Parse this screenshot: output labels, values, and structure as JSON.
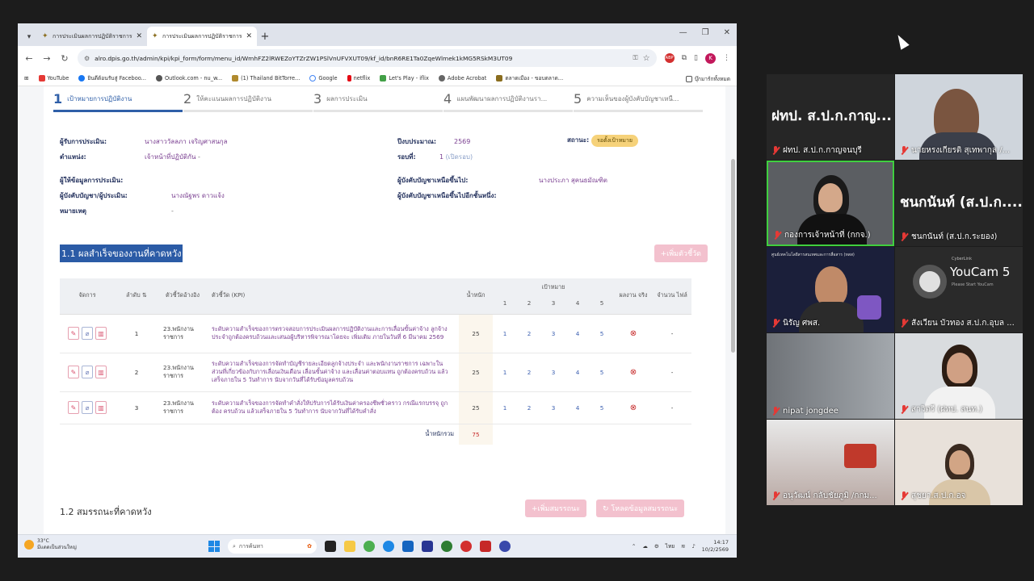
{
  "browser": {
    "tabs": [
      {
        "title": "การประเมินผลการปฏิบัติราชการ - ระ"
      },
      {
        "title": "การประเมินผลการปฏิบัติราชการ - ระ"
      }
    ],
    "url": "alro.dpis.go.th/admin/kpi/kpi_form/form/menu_id/WmhFZ2lRWEZoYTZrZW1PSlVnUFVXUT09/kf_id/bnR6RE1Ta0ZqeWlmek1kMG5RSkM3UT09",
    "profile_initial": "K",
    "bookmarks": [
      "YouTube",
      "ยินดีต้อนรับสู่ Faceboo...",
      "Outlook.com - nu_w...",
      "(1) Thailand BitTorre...",
      "Google",
      "netflix",
      "Let's Play - iflix",
      "Adobe Acrobat",
      "ตลาดเมือง - ขอบตลาด..."
    ],
    "bookmarks_all": "บุ๊กมาร์กทั้งหมด"
  },
  "steps": [
    {
      "num": "1",
      "label": "เป้าหมายการปฏิบัติงาน"
    },
    {
      "num": "2",
      "label": "ให้คะแนนผลการปฏิบัติงาน"
    },
    {
      "num": "3",
      "label": "ผลการประเมิน"
    },
    {
      "num": "4",
      "label": "แผนพัฒนาผลการปฏิบัติงานรา..."
    },
    {
      "num": "5",
      "label": "ความเห็นของผู้บังคับบัญชาเหนื..."
    }
  ],
  "info": {
    "assessee_label": "ผู้รับการประเมิน:",
    "assessee": "นางสาววัลลภา เจริญศาสนกุล",
    "position_label": "ตำแหน่ง:",
    "position": "เจ้าหน้าที่ปฏิบัติกัน",
    "position_dash": "-",
    "year_label": "ปีงบประมาณ:",
    "year": "2569",
    "round_label": "รอบที่:",
    "round": "1",
    "round_note": "(เปิดรอบ)",
    "status_label": "สถานะ:",
    "status": "รอตั้งเป้าหมาย",
    "provider_label": "ผู้ให้ข้อมูลการประเมิน:",
    "supervisor_label": "ผู้บังคับบัญชา/ผู้ประเมิน:",
    "supervisor": "นางณัฐพร ดาวแจ้ง",
    "note_label": "หมายเหตุ",
    "note": "-",
    "upper1_label": "ผู้บังคับบัญชาเหนือขึ้นไป:",
    "upper1": "นางประภา สุคนธมัณฑิต",
    "upper2_label": "ผู้บังคับบัญชาเหนือขึ้นไปอีกชั้นหนึ่ง:"
  },
  "section1": {
    "title": "1.1 ผลสำเร็จของงานที่คาดหวัง",
    "add_kpi": "+เพิ่มตัวชี้วัด",
    "headers": {
      "actions": "จัดการ",
      "order": "ลำดับ",
      "ref": "ตัวชี้วัดอ้างอิง",
      "kpi": "ตัวชี้วัด (KPI)",
      "weight": "น้ำหนัก",
      "target": "เป้าหมาย",
      "l1": "1",
      "l2": "2",
      "l3": "3",
      "l4": "4",
      "l5": "5",
      "actual": "ผลงาน จริง",
      "files": "จำนวน ไฟล์"
    },
    "rows": [
      {
        "order": "1",
        "ref": "23.พนักงาน ราชการ",
        "kpi": "ระดับความสำเร็จของการตรวจสอบการประเมินผลการปฏิบัติงานและการเลื่อนขั้นค่าจ้าง ลูกจ้างประจำถูกต้องครบถ้วนและเสนอผู้บริหารพิจารณาโดยจะ เพิ่มเติม ภายในวันที่ 6 มีนาคม 2569",
        "weight": "25",
        "l1": "1",
        "l2": "2",
        "l3": "3",
        "l4": "4",
        "l5": "5",
        "files": "-"
      },
      {
        "order": "2",
        "ref": "23.พนักงาน ราชการ",
        "kpi": "ระดับความสำเร็จของการจัดทำบัญชีรายละเอียดลูกจ้างประจำ และพนักงานราชการ เฉพาะใน ส่วนที่เกี่ยวข้องกับการเลื่อนเงินเดือน เลื่อนขั้นค่าจ้าง และเลื่อนค่าตอบแทน ถูกต้องครบถ้วน แล้วเสร็จภายใน 5 วันทำการ นับจากวันที่ได้รับข้อมูลครบถ้วน",
        "weight": "25",
        "l1": "1",
        "l2": "2",
        "l3": "3",
        "l4": "4",
        "l5": "5",
        "files": "-"
      },
      {
        "order": "3",
        "ref": "23.พนักงาน ราชการ",
        "kpi": "ระดับความสำเร็จของการจัดทำคำสั่งให้ปรับการได้รับเงินค่าครองชีพชั่วคราว กรณีแรกบรรจุ ถูกต้อง ครบถ้วน แล้วเสร็จภายใน 5 วันทำการ นับจากวันที่ได้รับคำสั่ง",
        "weight": "25",
        "l1": "1",
        "l2": "2",
        "l3": "3",
        "l4": "4",
        "l5": "5",
        "files": "-"
      }
    ],
    "total_label": "น้ำหนักรวม",
    "total": "75"
  },
  "section2": {
    "title": "1.2 สมรรถนะที่คาดหวัง",
    "add_btn": "+เพิ่มสมรรถนะ",
    "load_btn": "โหลดข้อมูลสมรรถนะ"
  },
  "taskbar": {
    "temp": "33°C",
    "weather": "มีแดดเป็นส่วนใหญ่",
    "search": "การค้นหา",
    "lang": "ไทย",
    "time": "14:17",
    "date": "10/2/2569"
  },
  "participants": [
    {
      "big": "ฝทป. ส.ป.ก.กาญ...",
      "name": "ฝทป. ส.ป.ก.กาญจนบุรี"
    },
    {
      "big": "",
      "name": "นายหรงเกียรติ สุเทพากุล /..."
    },
    {
      "big": "",
      "name": "กองการเจ้าหน้าที่ (กกจ.)"
    },
    {
      "big": "ชนกนันท์ (ส.ป.ก....",
      "name": "ชนกนันท์ (ส.ป.ก.ระยอง)"
    },
    {
      "big": "",
      "name": "นิรัญ ศพส."
    },
    {
      "big": "",
      "name": "สังเวียน บัวทอง ส.ป.ก.อุบล ..."
    },
    {
      "big": "",
      "name": "nipat jongdee"
    },
    {
      "big": "",
      "name": "สาวิตรี (ฝทป. สนท.)"
    },
    {
      "big": "",
      "name": "อนุวัฒน์ กลับชัยภูมิ /กกม..."
    },
    {
      "big": "",
      "name": "สุชยา.ส.ป.ก.อจ"
    }
  ],
  "youcam": {
    "title": "YouCam 5",
    "sub": "Please Start YouCam",
    "brand": "CyberLink"
  },
  "presenter_header": "ศูนย์เทคโนโลยีสารสนเทศและการสื่อสาร (ทสส)",
  "colors": {
    "accent": "#2f5fa8",
    "pink_btn": "#f3c1ce",
    "status_badge": "#f6d27a"
  }
}
